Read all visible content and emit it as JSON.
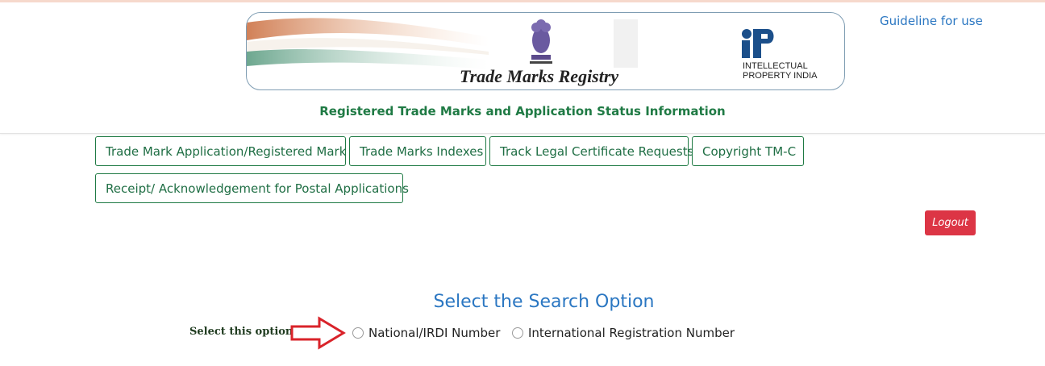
{
  "header": {
    "guideline_link": "Guideline for use",
    "banner": {
      "registry_title": "Trade Marks Registry",
      "ip_logo_text": "INTELLECTUAL\nPROPERTY INDIA"
    },
    "subtitle": "Registered Trade Marks and Application Status Information"
  },
  "tabs": [
    {
      "label": "Trade Mark Application/Registered Mark"
    },
    {
      "label": "Trade Marks Indexes"
    },
    {
      "label": "Track Legal Certificate Requests"
    },
    {
      "label": "Copyright TM-C"
    },
    {
      "label": "Receipt/ Acknowledgement for Postal Applications"
    }
  ],
  "logout_label": "Logout",
  "search": {
    "heading": "Select the Search Option",
    "select_label": "Select this option",
    "options": [
      {
        "label": "National/IRDI Number",
        "selected": false
      },
      {
        "label": "International Registration Number",
        "selected": false
      }
    ]
  },
  "colors": {
    "accent_green": "#1f7a44",
    "link_blue": "#2b77c2",
    "logout_red": "#dc3545",
    "arrow_red": "#d9232a"
  }
}
